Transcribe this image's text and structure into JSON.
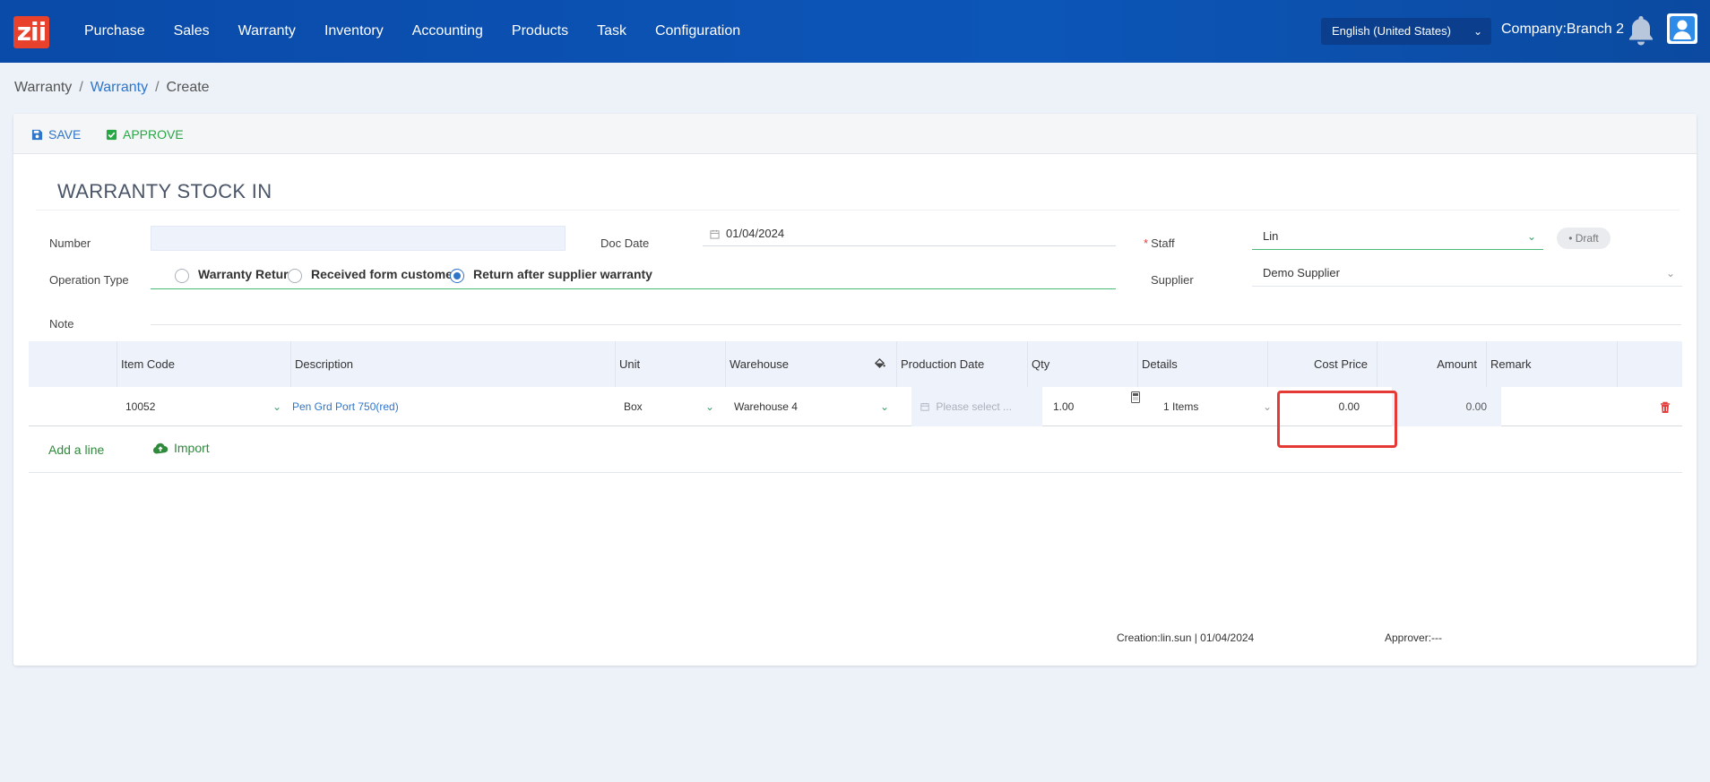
{
  "app": {
    "logo_text": "zii"
  },
  "nav": {
    "items": [
      "Purchase",
      "Sales",
      "Warranty",
      "Inventory",
      "Accounting",
      "Products",
      "Task",
      "Configuration"
    ],
    "language": "English (United States)",
    "company": "Company:Branch 2"
  },
  "breadcrumb": {
    "root": "Warranty",
    "parent": "Warranty",
    "current": "Create",
    "sep": "/"
  },
  "toolbar": {
    "save_label": "SAVE",
    "approve_label": "APPROVE"
  },
  "form": {
    "title": "WARRANTY STOCK IN",
    "number_label": "Number",
    "number_value": "",
    "doc_date_label": "Doc Date",
    "doc_date_value": "01/04/2024",
    "staff_label": "Staff",
    "staff_value": "Lin",
    "status": "Draft",
    "operation_type_label": "Operation Type",
    "operation_types": [
      "Warranty Return",
      "Received form customer",
      "Return after supplier warranty"
    ],
    "selected_operation_type": "Return after supplier warranty",
    "supplier_label": "Supplier",
    "supplier_value": "Demo Supplier",
    "note_label": "Note",
    "note_value": ""
  },
  "table": {
    "columns": [
      "Item Code",
      "Description",
      "Unit",
      "Warehouse",
      "Production Date",
      "Qty",
      "Details",
      "Cost Price",
      "Amount",
      "Remark"
    ],
    "rows": [
      {
        "item_code": "10052",
        "description": "Pen Grd Port 750(red)",
        "unit": "Box",
        "warehouse": "Warehouse 4",
        "production_date_placeholder": "Please select ...",
        "qty": "1.00",
        "details": "1 Items",
        "cost_price": "0.00",
        "amount": "0.00",
        "remark": ""
      }
    ],
    "add_line_label": "Add a line",
    "import_label": "Import"
  },
  "footer": {
    "creation": "Creation:lin.sun | 01/04/2024",
    "approver": "Approver:---"
  },
  "colors": {
    "nav_bg": "#0a4aa8",
    "accent_blue": "#2f75c9",
    "accent_green": "#28a745",
    "highlight_red": "#e53935"
  }
}
